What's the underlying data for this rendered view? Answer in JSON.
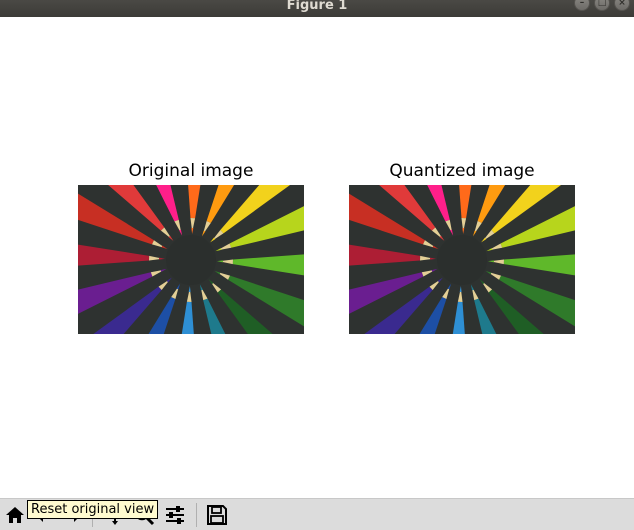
{
  "window": {
    "title": "Figure 1"
  },
  "subplots": [
    {
      "title": "Original image"
    },
    {
      "title": "Quantized image"
    }
  ],
  "image_colors": [
    "#ff1f8a",
    "#ff6a1a",
    "#ff9b10",
    "#f2d21c",
    "#b7d51c",
    "#5fb82a",
    "#2f7a2a",
    "#1f5e25",
    "#1e7a8c",
    "#2e8fd4",
    "#1d4fa5",
    "#3a2a8f",
    "#6a1e90",
    "#ad1e34",
    "#c72f23",
    "#e03a3a"
  ],
  "toolbar": {
    "buttons": [
      "home-icon",
      "back-icon",
      "forward-icon",
      "pan-icon",
      "zoom-icon",
      "configure-subplots-icon",
      "save-icon"
    ],
    "tooltip": "Reset original view"
  }
}
